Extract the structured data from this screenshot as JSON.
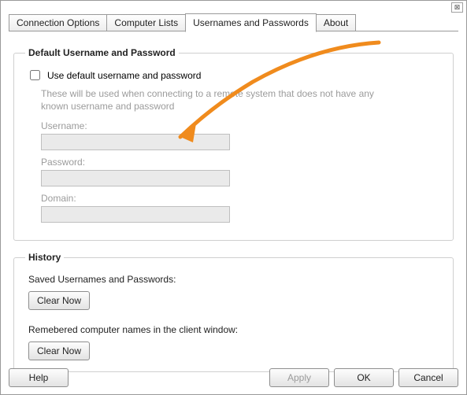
{
  "tabs": {
    "connection": "Connection Options",
    "computers": "Computer Lists",
    "usernames": "Usernames and Passwords",
    "about": "About"
  },
  "group_default": {
    "legend": "Default Username and Password",
    "checkbox_label": "Use default username and password",
    "hint": "These will be used when connecting to a remote system that does not have any known username and password",
    "username_label": "Username:",
    "username_value": "",
    "password_label": "Password:",
    "password_value": "",
    "domain_label": "Domain:",
    "domain_value": ""
  },
  "group_history": {
    "legend": "History",
    "saved_label": "Saved Usernames and Passwords:",
    "remembered_label": "Remebered computer names in the client window:",
    "clear_button": "Clear Now"
  },
  "buttons": {
    "help": "Help",
    "apply": "Apply",
    "ok": "OK",
    "cancel": "Cancel"
  },
  "close_glyph": "⊠"
}
